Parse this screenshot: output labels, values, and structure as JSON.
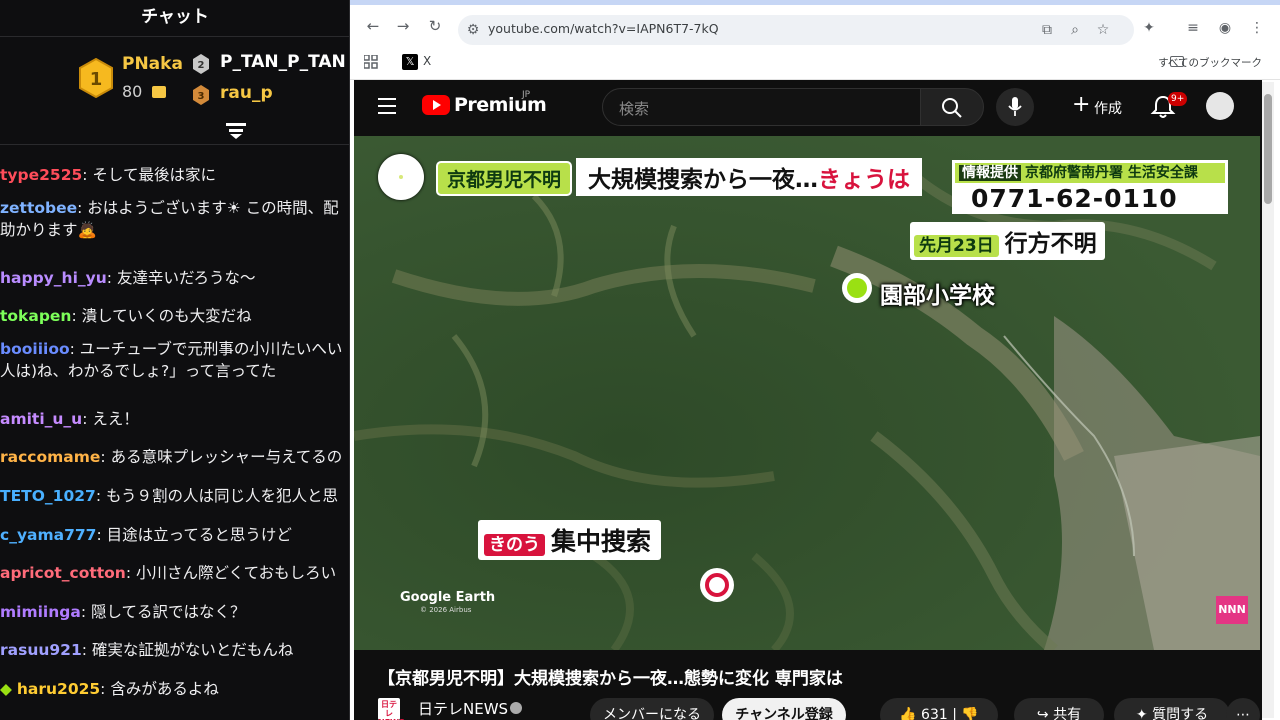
{
  "chat": {
    "title": "チャット",
    "leaderboard": [
      {
        "rank": "1",
        "name": "PNaka",
        "score": "80"
      },
      {
        "rank": "2",
        "name": "P_TAN_P_TAN"
      },
      {
        "rank": "3",
        "name": "rau_p"
      }
    ],
    "messages": [
      {
        "user": "type2525",
        "color": "#ff4d5a",
        "text": "そして最後は家に"
      },
      {
        "user": "zettobee",
        "color": "#7fb2ff",
        "text": "おはようございます☀ この時間、配",
        "text2": "助かります🙇"
      },
      {
        "user": "happy_hi_yu",
        "color": "#b98cff",
        "text": "友達辛いだろうな〜"
      },
      {
        "user": "tokapen",
        "color": "#7dff5a",
        "text": "潰していくのも大変だね"
      },
      {
        "user": "booiiioo",
        "color": "#6a8cff",
        "text": "ユーチューブで元刑事の小川たいへい",
        "text2": "人は)ね、わかるでしょ?」って言ってた"
      },
      {
        "user": "amiti_u_u",
        "color": "#c58bff",
        "text": "ええ！"
      },
      {
        "user": "raccomame",
        "color": "#ffb347",
        "text": "ある意味プレッシャー与えてるの"
      },
      {
        "user": "TETO_1027",
        "color": "#49b0ff",
        "text": "もう９割の人は同じ人を犯人と思"
      },
      {
        "user": "c_yama777",
        "color": "#4fb0ff",
        "text": "目途は立ってると思うけど"
      },
      {
        "user": "apricot_cotton",
        "color": "#ff6b7a",
        "text": "小川さん際どくておもしろい"
      },
      {
        "user": "mimiinga",
        "color": "#b07cff",
        "text": "隠してる訳ではなく？"
      },
      {
        "user": "rasuu921",
        "color": "#a0a0ff",
        "text": "確実な証拠がないとだもんね"
      },
      {
        "user": "haru2025",
        "color": "#ffcc33",
        "text": "含みがあるよね"
      }
    ]
  },
  "browser": {
    "url": "youtube.com/watch?v=IAPN6T7-7kQ",
    "bookmark_x": "X",
    "bookmarks_all": "すべてのブックマーク"
  },
  "youtube": {
    "brand": "Premium",
    "region": "JP",
    "search_placeholder": "検索",
    "create_label": "作成",
    "notification_badge": "9+",
    "video_title": "【京都男児不明】大規模捜索から一夜…態勢に変化 専門家は",
    "channel_name": "日テレNEWS",
    "channel_logo": "日テレ NEWS",
    "buttons": {
      "member": "メンバーになる",
      "subscribe": "チャンネル登録",
      "like_count": "631",
      "share": "共有",
      "ask": "質問する"
    }
  },
  "video": {
    "tag1": "京都男児不明",
    "headline_a": "大規模捜索から一夜…",
    "headline_b": "きょうは",
    "info_tag": "情報提供",
    "info_source": "京都府警南丹署 生活安全課",
    "phone": "0771-62-0110",
    "missing_tag": "先月23日",
    "missing_text": "行方不明",
    "school": "園部小学校",
    "search_tag": "きのう",
    "search_text": "集中捜索",
    "google_earth": "Google Earth",
    "google_earth_sub": "© 2026 Airbus",
    "ntv_logo": "NNN"
  }
}
